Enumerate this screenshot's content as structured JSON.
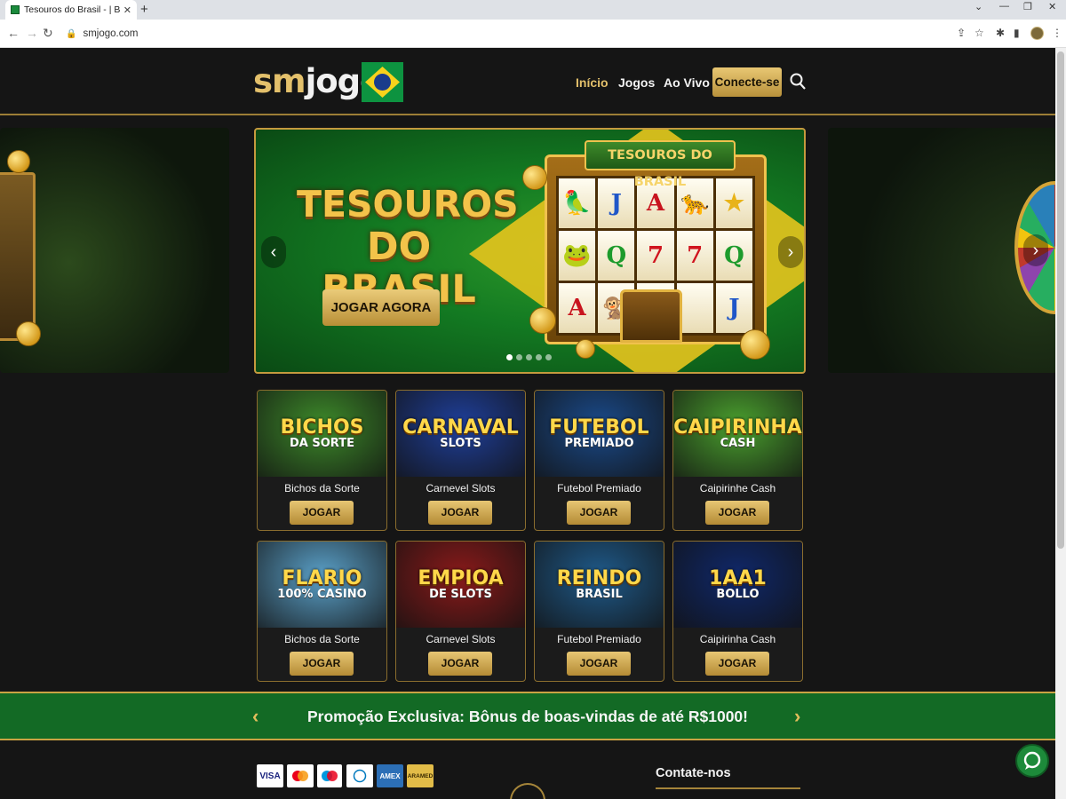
{
  "browser": {
    "tab_title": "Tesouros do Brasil - | Braline",
    "new_tab": "+",
    "url": "smjogo.com"
  },
  "header": {
    "logo_sm": "sm",
    "logo_jogo": "jogo",
    "nav": [
      "Início",
      "Jogos",
      "Ao Vivo"
    ],
    "cta": "Conecte-se"
  },
  "hero": {
    "title_line1": "TESOUROS",
    "title_line2": "DO BRASIL",
    "button": "JOGAR AGORA",
    "slot_banner": "TESOUROS DO BRASIL",
    "reel_symbols": [
      "🦜",
      "J",
      "A",
      "🐆",
      "★",
      "🐸",
      "Q",
      "7",
      "7",
      "Q",
      "A",
      "🐒",
      "",
      "",
      "J"
    ],
    "active_slide": 1,
    "slide_count": 5
  },
  "games": [
    {
      "thumb_line1": "BICHOS",
      "thumb_line2": "DA SORTE",
      "name": "Bichos da Sorte",
      "button": "JOGAR",
      "bg": "#3d8a2a"
    },
    {
      "thumb_line1": "CARNAVAL",
      "thumb_line2": "SLOTS",
      "name": "Carnevel Slots",
      "button": "JOGAR",
      "bg": "#1f3f9a"
    },
    {
      "thumb_line1": "FUTEBOL",
      "thumb_line2": "PREMIADO",
      "name": "Futebol Premiado",
      "button": "JOGAR",
      "bg": "#1a4a8a"
    },
    {
      "thumb_line1": "CAIPIRINHA",
      "thumb_line2": "CASH",
      "name": "Caipirinhe Cash",
      "button": "JOGAR",
      "bg": "#4aa02e"
    },
    {
      "thumb_line1": "FLARIO",
      "thumb_line2": "100% CASINO",
      "name": "Bichos da Sorte",
      "button": "JOGAR",
      "bg": "#5aa0c8"
    },
    {
      "thumb_line1": "EMPIOA",
      "thumb_line2": "DE SLOTS",
      "name": "Carnevel Slots",
      "button": "JOGAR",
      "bg": "#8a1a1a"
    },
    {
      "thumb_line1": "REINDO",
      "thumb_line2": "BRASIL",
      "name": "Futebol Premiado",
      "button": "JOGAR",
      "bg": "#1f5a8a"
    },
    {
      "thumb_line1": "1AA1",
      "thumb_line2": "BOLLO",
      "name": "Caipirinha Cash",
      "button": "JOGAR",
      "bg": "#10286a"
    }
  ],
  "promo": {
    "text": "Promoção Exclusiva: Bônus de boas-vindas de até R$1000!"
  },
  "footer": {
    "payments": [
      "VISA",
      "",
      "",
      "",
      "AMEX",
      "ARAMED"
    ],
    "contact_title": "Contate-nos"
  },
  "colors": {
    "gold": "#e3c06b",
    "green_bar": "#136a25",
    "page_bg": "#151515"
  }
}
